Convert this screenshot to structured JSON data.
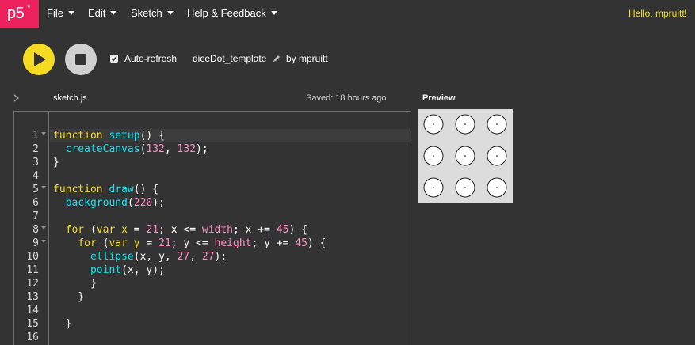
{
  "nav": {
    "logo": "p5",
    "logo_mark": "*",
    "menus": [
      "File",
      "Edit",
      "Sketch",
      "Help & Feedback"
    ],
    "greeting": "Hello, mpruitt!"
  },
  "toolbar": {
    "auto_refresh_label": "Auto-refresh",
    "auto_refresh_checked": true,
    "sketch_name": "diceDot_template",
    "by_user": "by mpruitt"
  },
  "editor": {
    "file_name": "sketch.js",
    "saved_status": "Saved: 18 hours ago",
    "lines": [
      "function setup() {",
      "  createCanvas(132, 132);",
      "}",
      "",
      "function draw() {",
      "  background(220);",
      "",
      "  for (var x = 21; x <= width; x += 45) {",
      "    for (var y = 21; y <= height; y += 45) {",
      "      ellipse(x, y, 27, 27);",
      "      point(x, y);",
      "      }",
      "    }",
      "",
      "  }",
      ""
    ]
  },
  "preview": {
    "label": "Preview",
    "circles": {
      "columns": 3,
      "rows": 3
    }
  },
  "colors": {
    "accent_yellow": "#f5dc23",
    "brand_pink": "#ed225d",
    "background": "#333333"
  }
}
